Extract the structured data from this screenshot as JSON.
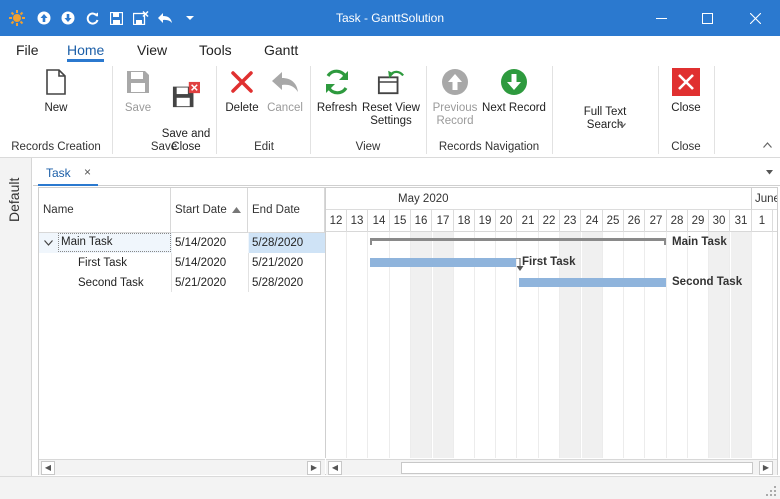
{
  "window": {
    "title": "Task - GanttSolution",
    "accent": "#2b79cf"
  },
  "menu": {
    "tabs": [
      {
        "label": "File"
      },
      {
        "label": "Home"
      },
      {
        "label": "View"
      },
      {
        "label": "Tools"
      },
      {
        "label": "Gantt"
      }
    ],
    "active": "Home"
  },
  "ribbon": {
    "new_label": "New",
    "save_label": "Save",
    "save_close_label": "Save and\nClose",
    "delete_label": "Delete",
    "cancel_label": "Cancel",
    "refresh_label": "Refresh",
    "reset_view_label": "Reset View\nSettings",
    "previous_label": "Previous\nRecord",
    "next_label": "Next Record",
    "fulltext_label": "Full Text\nSearch",
    "close_label": "Close",
    "groups": {
      "records_creation": "Records Creation",
      "save": "Save",
      "edit": "Edit",
      "view": "View",
      "records_navigation": "Records Navigation",
      "close": "Close"
    }
  },
  "sidebar": {
    "label": "Default"
  },
  "doc_tab": {
    "label": "Task",
    "close": "×"
  },
  "grid": {
    "columns": {
      "name": "Name",
      "start": "Start Date",
      "end": "End Date"
    },
    "rows": [
      {
        "name": "Main Task",
        "start": "5/14/2020",
        "end": "5/28/2020"
      },
      {
        "name": "First Task",
        "start": "5/14/2020",
        "end": "5/21/2020"
      },
      {
        "name": "Second Task",
        "start": "5/21/2020",
        "end": "5/28/2020"
      }
    ]
  },
  "gantt": {
    "month_may": "May 2020",
    "month_june": "June",
    "days": [
      "12",
      "13",
      "14",
      "15",
      "16",
      "17",
      "18",
      "19",
      "20",
      "21",
      "22",
      "23",
      "24",
      "25",
      "26",
      "27",
      "28",
      "29",
      "30",
      "31",
      "1"
    ],
    "bars": [
      {
        "task": "Main Task",
        "label": "Main Task",
        "start_day": "14",
        "end_day": "27",
        "summary": true
      },
      {
        "task": "First Task",
        "label": "First Task",
        "start_day": "14",
        "end_day": "20",
        "summary": false
      },
      {
        "task": "Second Task",
        "label": "Second Task",
        "start_day": "21",
        "end_day": "27",
        "summary": false
      }
    ]
  }
}
